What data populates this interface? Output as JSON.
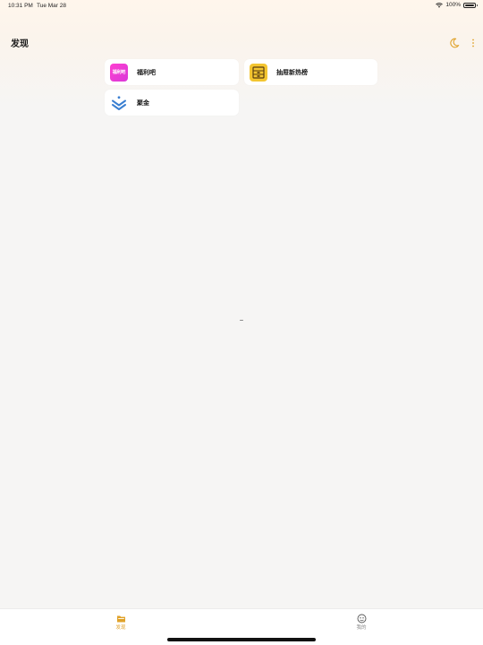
{
  "status_bar": {
    "time": "10:31 PM",
    "date": "Tue Mar 28",
    "battery_text": "100%",
    "wifi_icon": "wifi-icon",
    "battery_icon": "battery-icon"
  },
  "nav": {
    "title": "发现",
    "theme_icon": "moon-icon",
    "more_icon": "more-vertical-icon"
  },
  "sources": [
    {
      "label": "福利吧",
      "logo_text": "福利吧",
      "icon": "fuliba-logo"
    },
    {
      "label": "抽屉新热榜",
      "icon": "chouti-logo"
    },
    {
      "label": "聚金",
      "icon": "jujin-logo"
    }
  ],
  "tabs": [
    {
      "label": "发现",
      "icon": "folder-icon",
      "active": true
    },
    {
      "label": "我的",
      "icon": "profile-icon",
      "active": false
    }
  ],
  "colors": {
    "accent": "#e0a22a",
    "background": "#f6f5f4",
    "card": "#ffffff",
    "fuliba_brand": "#e83cd6",
    "chouti_brand": "#f3c531",
    "jujin_brand": "#3a7fd1"
  }
}
